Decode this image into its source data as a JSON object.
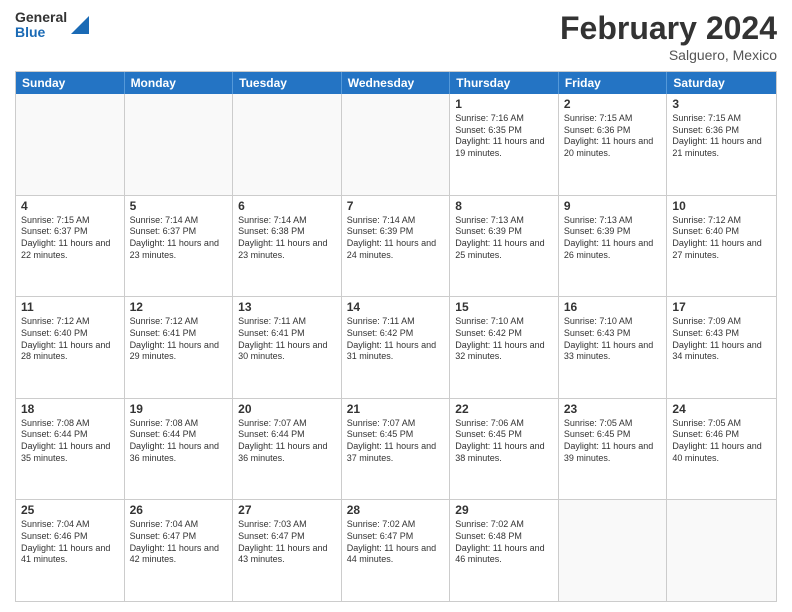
{
  "header": {
    "logo_general": "General",
    "logo_blue": "Blue",
    "month_year": "February 2024",
    "location": "Salguero, Mexico"
  },
  "days_of_week": [
    "Sunday",
    "Monday",
    "Tuesday",
    "Wednesday",
    "Thursday",
    "Friday",
    "Saturday"
  ],
  "weeks": [
    [
      {
        "day": "",
        "info": ""
      },
      {
        "day": "",
        "info": ""
      },
      {
        "day": "",
        "info": ""
      },
      {
        "day": "",
        "info": ""
      },
      {
        "day": "1",
        "info": "Sunrise: 7:16 AM\nSunset: 6:35 PM\nDaylight: 11 hours\nand 19 minutes."
      },
      {
        "day": "2",
        "info": "Sunrise: 7:15 AM\nSunset: 6:36 PM\nDaylight: 11 hours\nand 20 minutes."
      },
      {
        "day": "3",
        "info": "Sunrise: 7:15 AM\nSunset: 6:36 PM\nDaylight: 11 hours\nand 21 minutes."
      }
    ],
    [
      {
        "day": "4",
        "info": "Sunrise: 7:15 AM\nSunset: 6:37 PM\nDaylight: 11 hours\nand 22 minutes."
      },
      {
        "day": "5",
        "info": "Sunrise: 7:14 AM\nSunset: 6:37 PM\nDaylight: 11 hours\nand 23 minutes."
      },
      {
        "day": "6",
        "info": "Sunrise: 7:14 AM\nSunset: 6:38 PM\nDaylight: 11 hours\nand 23 minutes."
      },
      {
        "day": "7",
        "info": "Sunrise: 7:14 AM\nSunset: 6:39 PM\nDaylight: 11 hours\nand 24 minutes."
      },
      {
        "day": "8",
        "info": "Sunrise: 7:13 AM\nSunset: 6:39 PM\nDaylight: 11 hours\nand 25 minutes."
      },
      {
        "day": "9",
        "info": "Sunrise: 7:13 AM\nSunset: 6:39 PM\nDaylight: 11 hours\nand 26 minutes."
      },
      {
        "day": "10",
        "info": "Sunrise: 7:12 AM\nSunset: 6:40 PM\nDaylight: 11 hours\nand 27 minutes."
      }
    ],
    [
      {
        "day": "11",
        "info": "Sunrise: 7:12 AM\nSunset: 6:40 PM\nDaylight: 11 hours\nand 28 minutes."
      },
      {
        "day": "12",
        "info": "Sunrise: 7:12 AM\nSunset: 6:41 PM\nDaylight: 11 hours\nand 29 minutes."
      },
      {
        "day": "13",
        "info": "Sunrise: 7:11 AM\nSunset: 6:41 PM\nDaylight: 11 hours\nand 30 minutes."
      },
      {
        "day": "14",
        "info": "Sunrise: 7:11 AM\nSunset: 6:42 PM\nDaylight: 11 hours\nand 31 minutes."
      },
      {
        "day": "15",
        "info": "Sunrise: 7:10 AM\nSunset: 6:42 PM\nDaylight: 11 hours\nand 32 minutes."
      },
      {
        "day": "16",
        "info": "Sunrise: 7:10 AM\nSunset: 6:43 PM\nDaylight: 11 hours\nand 33 minutes."
      },
      {
        "day": "17",
        "info": "Sunrise: 7:09 AM\nSunset: 6:43 PM\nDaylight: 11 hours\nand 34 minutes."
      }
    ],
    [
      {
        "day": "18",
        "info": "Sunrise: 7:08 AM\nSunset: 6:44 PM\nDaylight: 11 hours\nand 35 minutes."
      },
      {
        "day": "19",
        "info": "Sunrise: 7:08 AM\nSunset: 6:44 PM\nDaylight: 11 hours\nand 36 minutes."
      },
      {
        "day": "20",
        "info": "Sunrise: 7:07 AM\nSunset: 6:44 PM\nDaylight: 11 hours\nand 36 minutes."
      },
      {
        "day": "21",
        "info": "Sunrise: 7:07 AM\nSunset: 6:45 PM\nDaylight: 11 hours\nand 37 minutes."
      },
      {
        "day": "22",
        "info": "Sunrise: 7:06 AM\nSunset: 6:45 PM\nDaylight: 11 hours\nand 38 minutes."
      },
      {
        "day": "23",
        "info": "Sunrise: 7:05 AM\nSunset: 6:45 PM\nDaylight: 11 hours\nand 39 minutes."
      },
      {
        "day": "24",
        "info": "Sunrise: 7:05 AM\nSunset: 6:46 PM\nDaylight: 11 hours\nand 40 minutes."
      }
    ],
    [
      {
        "day": "25",
        "info": "Sunrise: 7:04 AM\nSunset: 6:46 PM\nDaylight: 11 hours\nand 41 minutes."
      },
      {
        "day": "26",
        "info": "Sunrise: 7:04 AM\nSunset: 6:47 PM\nDaylight: 11 hours\nand 42 minutes."
      },
      {
        "day": "27",
        "info": "Sunrise: 7:03 AM\nSunset: 6:47 PM\nDaylight: 11 hours\nand 43 minutes."
      },
      {
        "day": "28",
        "info": "Sunrise: 7:02 AM\nSunset: 6:47 PM\nDaylight: 11 hours\nand 44 minutes."
      },
      {
        "day": "29",
        "info": "Sunrise: 7:02 AM\nSunset: 6:48 PM\nDaylight: 11 hours\nand 46 minutes."
      },
      {
        "day": "",
        "info": ""
      },
      {
        "day": "",
        "info": ""
      }
    ]
  ]
}
